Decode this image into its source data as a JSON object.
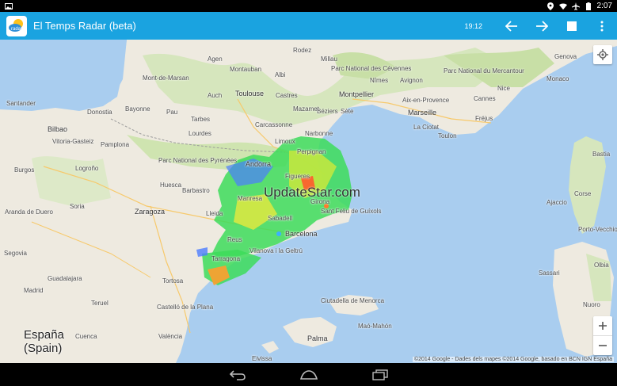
{
  "status": {
    "time": "2:07"
  },
  "app": {
    "title": "El Temps Radar (beta)",
    "radar_time": "19:12"
  },
  "map": {
    "watermark": "UpdateStar.com",
    "copyright": "©2014 Google - Dades dels mapes ©2014 Google, basado en BCN IGN España",
    "country_label_line1": "España",
    "country_label_line2": "(Spain)",
    "labels": {
      "genova": "Genova",
      "monaco": "Monaco",
      "nice": "Nice",
      "cannes": "Cannes",
      "frejus": "Fréjus",
      "toulon": "Toulon",
      "marseille": "Marseille",
      "aix": "Aix-en-Provence",
      "la_ciotat": "La Ciotat",
      "avignon": "Avignon",
      "nimes": "Nîmes",
      "montpellier": "Montpellier",
      "sete": "Sète",
      "beziers": "Béziers",
      "narbonne": "Narbonne",
      "perpignan": "Perpignan",
      "carcassonne": "Carcassonne",
      "toulouse": "Toulouse",
      "montauban": "Montauban",
      "albi": "Albi",
      "castres": "Castres",
      "mazamet": "Mazamet",
      "rodez": "Rodez",
      "millau": "Millau",
      "limoux": "Limoux",
      "agen": "Agen",
      "auch": "Auch",
      "tarbes": "Tarbes",
      "lourdes": "Lourdes",
      "pau": "Pau",
      "bayonne": "Bayonne",
      "santander": "Santander",
      "bilbao": "Bilbao",
      "donostia": "Donostia",
      "vitoria": "Vitoria-Gasteiz",
      "pamplona": "Pamplona",
      "burgos": "Burgos",
      "logrono": "Logroño",
      "soria": "Soria",
      "huesca": "Huesca",
      "zaragoza": "Zaragoza",
      "barbastro": "Barbastro",
      "lleida": "Lleida",
      "manresa": "Manresa",
      "sabadell": "Sabadell",
      "barcelona": "Barcelona",
      "girona": "Girona",
      "andorra": "Andorra",
      "sant_feliu": "Sant Feliu de Guíxols",
      "reus": "Reus",
      "vilanova": "Vilanova i la Geltrú",
      "tortosa": "Tortosa",
      "teruel": "Teruel",
      "castellon": "Castelló de la Plana",
      "valencia": "València",
      "cuenca": "Cuenca",
      "guadalajara": "Guadalajara",
      "madrid": "Madrid",
      "segovia": "Segovia",
      "aranda": "Aranda de Duero",
      "ciutadella": "Ciutadella de Menorca",
      "mahon": "Maó-Mahón",
      "palma": "Palma",
      "ibiza": "Eivissa",
      "sassari": "Sassari",
      "ajaccio": "Ajaccio",
      "bastia": "Bastia",
      "corse": "Corse",
      "porto_vecchio": "Porto-Vecchio",
      "nuoro": "Nuoro",
      "olbia": "Olbia",
      "parc_cevennes": "Parc National des Cévennes",
      "parc_mercantour": "Parc National du Mercantour",
      "parc_pyrenees": "Parc National des Pyrénées",
      "mont_de_marsan": "Mont-de-Marsan",
      "figueres": "Figueres",
      "tarragona": "Tarragona"
    }
  },
  "colors": {
    "appbar": "#1aa3e0",
    "sea": "#a9cdef",
    "land": "#eeeae0",
    "green": "#cfe4b0"
  }
}
